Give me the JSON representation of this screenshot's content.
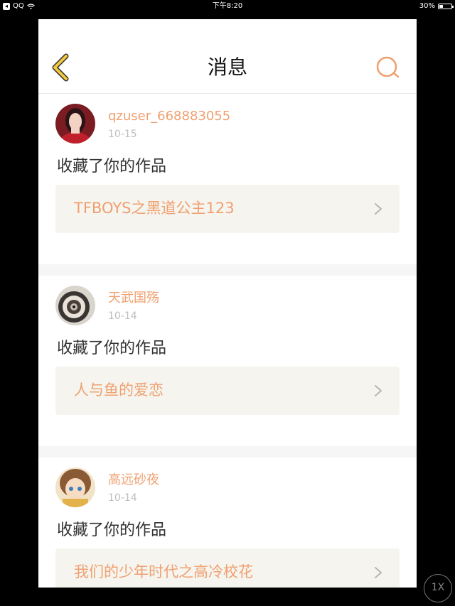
{
  "status_bar": {
    "app_label": "QQ",
    "time": "下午8:20",
    "battery": "30%",
    "battery_level": 0.3
  },
  "nav": {
    "title": "消息",
    "back_icon": "chevron-left-icon",
    "search_icon": "search-icon"
  },
  "messages": [
    {
      "username": "qzuser_668883055",
      "date": "10-15",
      "action": "收藏了你的作品",
      "work_title": "TFBOYS之黑道公主123"
    },
    {
      "username": "天武国殇",
      "date": "10-14",
      "action": "收藏了你的作品",
      "work_title": "人与鱼的爱恋"
    },
    {
      "username": "高远砂夜",
      "date": "10-14",
      "action": "收藏了你的作品",
      "work_title": "我们的少年时代之高冷校花"
    }
  ],
  "zoom_button": "1X",
  "colors": {
    "accent": "#f0a070",
    "back_arrow": "#f3c93d",
    "card_bg": "#f5f4ee"
  }
}
